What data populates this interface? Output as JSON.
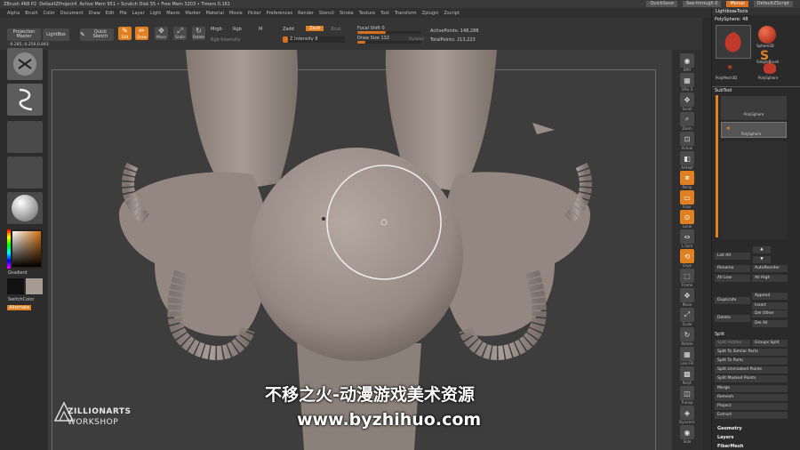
{
  "titlebar": {
    "app": "ZBrush 4R8 P2",
    "document": "DefaultZProject4",
    "stats": "Active Mem 951  •  Scratch Disk 55  •  Free Mem 3203  •  Timers 0.161",
    "quicksave": "QuickSave",
    "seethrough": "See-through  0",
    "menus": "Menus",
    "script": "DefaultZScript"
  },
  "menubar": [
    "Alpha",
    "Brush",
    "Color",
    "Document",
    "Draw",
    "Edit",
    "File",
    "Layer",
    "Light",
    "Macro",
    "Marker",
    "Material",
    "Movie",
    "Picker",
    "Preferences",
    "Render",
    "Stencil",
    "Stroke",
    "Texture",
    "Tool",
    "Transform",
    "Zplugin",
    "Zscript"
  ],
  "shelf": {
    "projection_master": "Projection Master",
    "lightbox": "LightBox",
    "quick_sketch": "Quick Sketch",
    "edit": "Edit",
    "draw": "Draw",
    "move": "Move",
    "scale": "Scale",
    "rotate": "Rotate",
    "mrgb": "Mrgb",
    "rgb": "Rgb",
    "m": "M",
    "rgb_intensity": "Rgb Intensity",
    "zadd": "Zadd",
    "zsub": "Zsub",
    "zcut": "Zcut",
    "z_intensity": "Z Intensity 8",
    "focal_shift": "Focal Shift 0",
    "draw_size": "Draw Size 132",
    "dynamic": "Dynamic",
    "active_points": "ActivePoints: 148,288",
    "total_points": "TotalPoints: 213,223",
    "coords": "-0.285,-0.256,0.843",
    "z_intensity_level": 0.08,
    "focal_shift_level": 0.45,
    "draw_size_level": 0.13
  },
  "lefttray": {
    "gradient": "Gradient",
    "switch_color": "SwitchColor",
    "alternate": "Alternate"
  },
  "rshelf": [
    "BPR",
    "SPix 3",
    "Scroll",
    "Zoom",
    "Actual",
    "AAHalf",
    "Persp",
    "Floor",
    "Local",
    "L.Sym",
    "Gxyz",
    "Frame",
    "Move",
    "Scale",
    "Rotate",
    "Line Fill",
    "PolyF",
    "Transp",
    "Dynamic",
    "Solo"
  ],
  "rpanel": {
    "lightbox_tools": "Lightbox▸Tools",
    "tool_name": "PolySphere: 48",
    "subtools": [
      "PolySphere",
      "Sphere3D",
      "SimpleBrush",
      "PolyMesh3D",
      "PolySphere"
    ],
    "subtool_header": "SubTool",
    "subtool_items": [
      "PolySphere",
      "PolySphere"
    ],
    "list_all": "List All",
    "rename": "Rename",
    "autoreorder": "AutoReorder",
    "all_low": "All Low",
    "all_high": "All High",
    "duplicate": "Duplicate",
    "append": "Append",
    "insert": "Insert",
    "delete": "Delete",
    "del_other": "Del Other",
    "del_all": "Del All",
    "split": "Split",
    "split_hidden": "Split Hidden",
    "groups_split": "Groups Split",
    "split_similar": "Split To Similar Parts",
    "split_parts": "Split To Parts",
    "split_unmasked": "Split Unmasked Points",
    "split_masked": "Split Masked Points",
    "merge": "Merge",
    "remesh": "Remesh",
    "project": "Project",
    "extract": "Extract",
    "geometry": "Geometry",
    "layers": "Layers",
    "fibermesh": "FiberMesh"
  },
  "watermark": {
    "logo_line1": "ZILLIONARTS",
    "logo_line2": "WORKSHOP",
    "cn": "不移之火-动漫游戏美术资源",
    "url": "www.byzhihuo.com"
  },
  "colors": {
    "accent": "#e08020",
    "panel": "#2a2a2a",
    "mesh": "#9d8f88"
  }
}
